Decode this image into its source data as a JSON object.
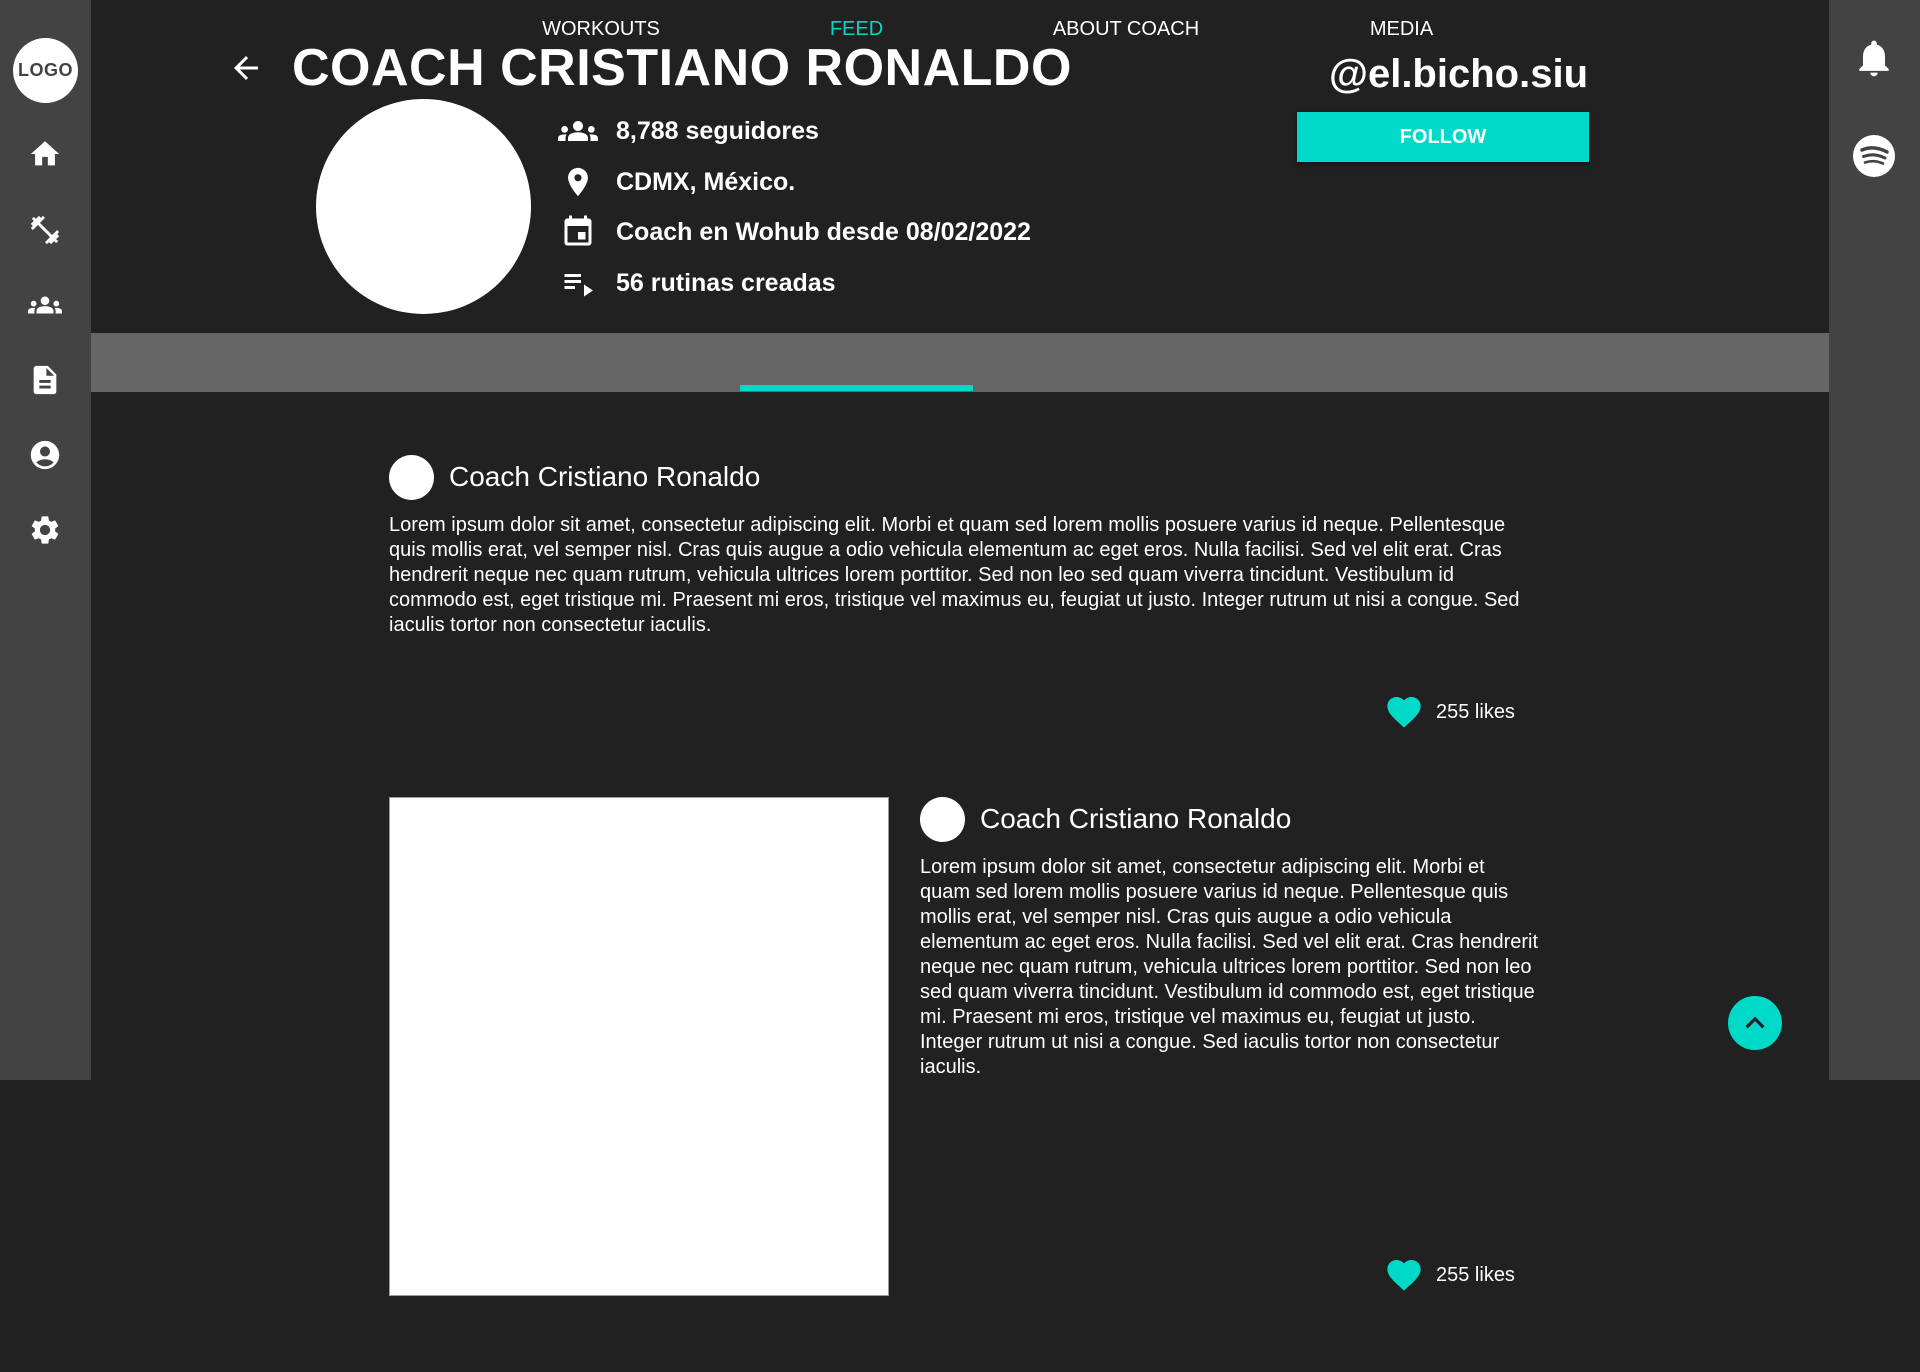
{
  "sidebar": {
    "logo": "LOGO",
    "items": [
      {
        "icon": "home-icon"
      },
      {
        "icon": "dumbbell-icon"
      },
      {
        "icon": "group-icon"
      },
      {
        "icon": "document-icon"
      },
      {
        "icon": "account-icon"
      },
      {
        "icon": "settings-icon"
      }
    ]
  },
  "right_sidebar": {
    "items": [
      {
        "icon": "bell-icon"
      },
      {
        "icon": "spotify-icon"
      }
    ]
  },
  "profile": {
    "title": "COACH CRISTIANO RONALDO",
    "handle": "@el.bicho.siu",
    "follow_label": "FOLLOW",
    "stats": [
      {
        "icon": "followers-icon",
        "text": "8,788 seguidores"
      },
      {
        "icon": "location-icon",
        "text": "CDMX, México."
      },
      {
        "icon": "calendar-icon",
        "text": "Coach en Wohub desde 08/02/2022"
      },
      {
        "icon": "playlist-icon",
        "text": "56 rutinas creadas"
      }
    ]
  },
  "tabs": [
    {
      "label": "WORKOUTS",
      "active": false
    },
    {
      "label": "FEED",
      "active": true
    },
    {
      "label": "ABOUT COACH",
      "active": false
    },
    {
      "label": "MEDIA",
      "active": false
    }
  ],
  "posts": [
    {
      "author": "Coach Cristiano Ronaldo",
      "body": "Lorem ipsum dolor sit amet, consectetur adipiscing elit. Morbi et quam sed lorem mollis posuere varius id neque. Pellentesque quis mollis erat, vel semper nisl. Cras quis augue a odio vehicula elementum ac eget eros. Nulla facilisi. Sed vel elit erat. Cras hendrerit neque nec quam rutrum, vehicula ultrices lorem porttitor. Sed non leo sed quam viverra tincidunt. Vestibulum id commodo est, eget tristique mi. Praesent mi eros, tristique vel maximus eu, feugiat ut justo. Integer rutrum ut nisi a congue. Sed iaculis tortor non consectetur iaculis.",
      "likes": "255 likes",
      "has_image": false
    },
    {
      "author": "Coach Cristiano Ronaldo",
      "body": "Lorem ipsum dolor sit amet, consectetur adipiscing elit. Morbi et quam sed lorem mollis posuere varius id neque. Pellentesque quis mollis erat, vel semper nisl. Cras quis augue a odio vehicula elementum ac eget eros. Nulla facilisi. Sed vel elit erat. Cras hendrerit neque nec quam rutrum, vehicula ultrices lorem porttitor. Sed non leo sed quam viverra tincidunt. Vestibulum id commodo est, eget tristique mi. Praesent mi eros, tristique vel maximus eu, feugiat ut justo. Integer rutrum ut nisi a congue. Sed iaculis tortor non consectetur iaculis.",
      "likes": "255 likes",
      "has_image": true
    }
  ],
  "colors": {
    "accent": "#00d9c7",
    "background": "#212121",
    "sidebar": "#434343",
    "tabbar": "#656565"
  }
}
